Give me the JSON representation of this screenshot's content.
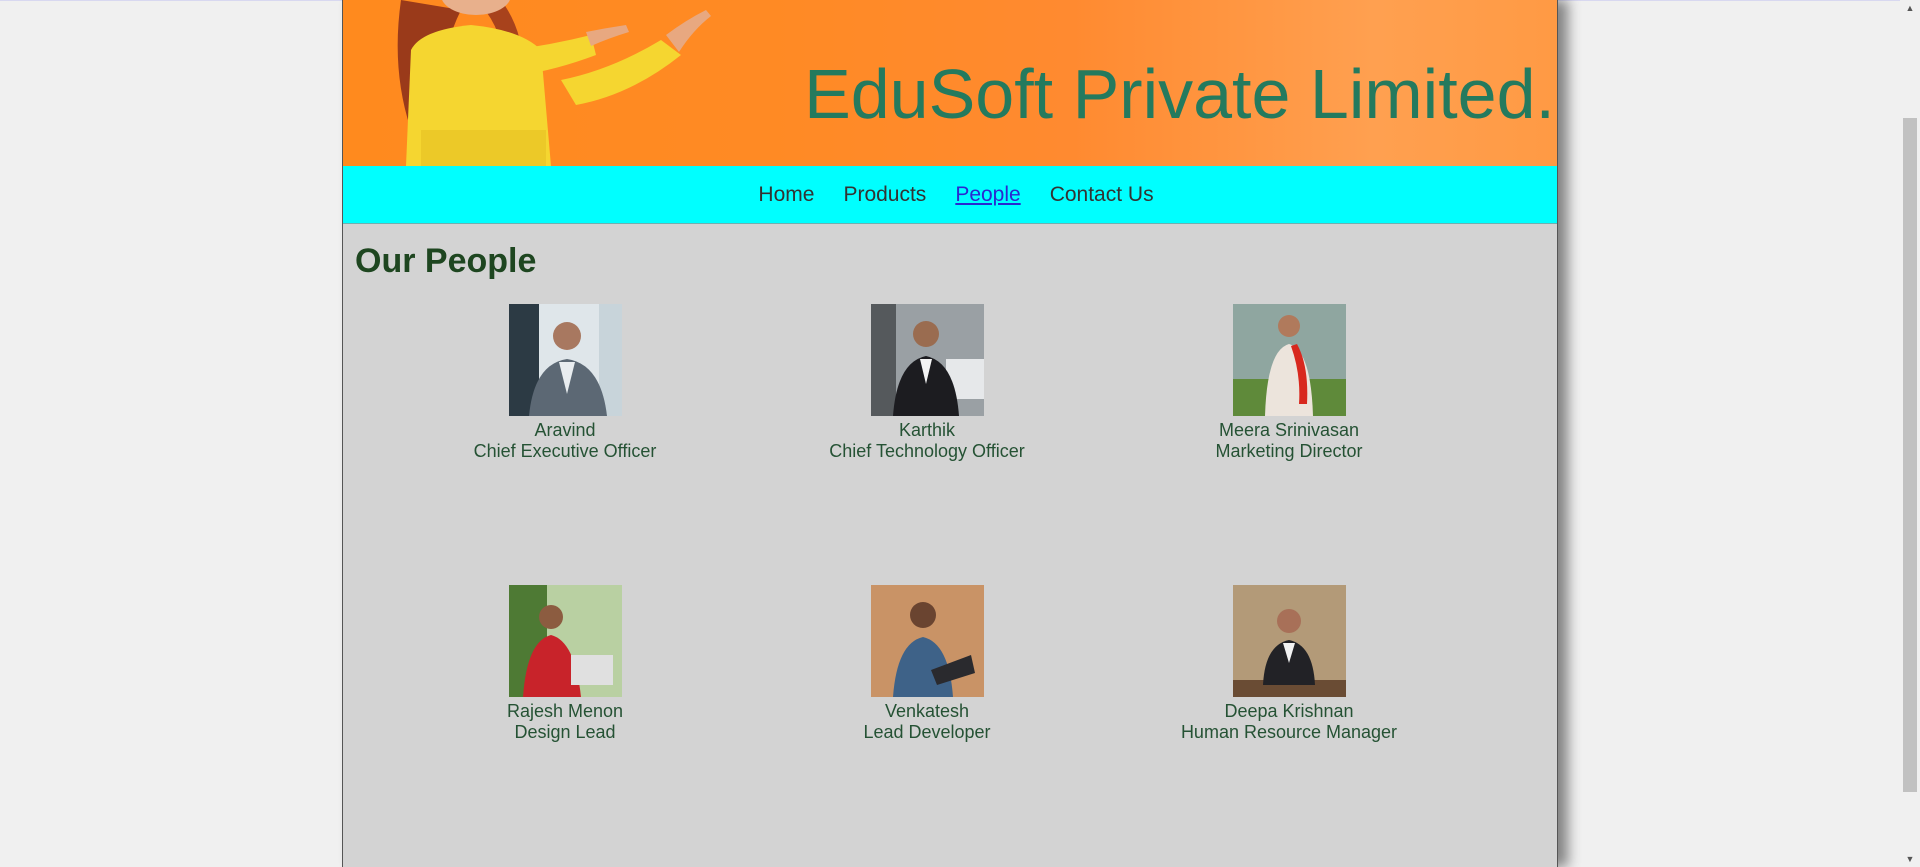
{
  "banner": {
    "title": "EduSoft Private Limited."
  },
  "nav": {
    "items": [
      {
        "label": "Home",
        "active": false
      },
      {
        "label": "Products",
        "active": false
      },
      {
        "label": "People",
        "active": true
      },
      {
        "label": "Contact Us",
        "active": false
      }
    ]
  },
  "main": {
    "heading": "Our People",
    "people": [
      {
        "name": "Aravind",
        "role": "Chief Executive Officer"
      },
      {
        "name": "Karthik",
        "role": "Chief Technology Officer"
      },
      {
        "name": "Meera Srinivasan",
        "role": "Marketing Director"
      },
      {
        "name": "Rajesh Menon",
        "role": "Design Lead"
      },
      {
        "name": "Venkatesh",
        "role": "Lead Developer"
      },
      {
        "name": "Deepa Krishnan",
        "role": "Human Resource Manager"
      }
    ]
  },
  "colors": {
    "banner_orange": "#ff8a24",
    "title_green": "#247a5e",
    "nav_cyan": "#00ffff",
    "content_gray": "#d3d3d3",
    "heading_green": "#1e4620",
    "active_link": "#2a28d0"
  }
}
